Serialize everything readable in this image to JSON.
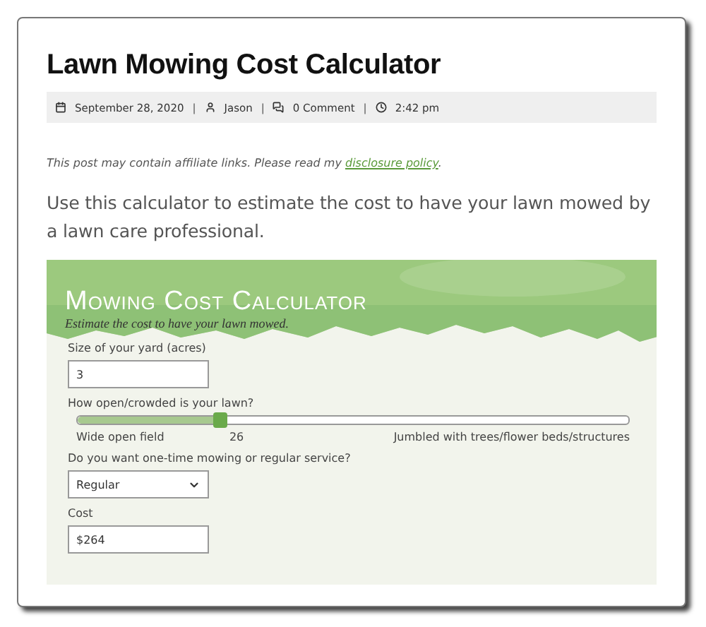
{
  "title": "Lawn Mowing Cost Calculator",
  "meta": [
    {
      "kind": "date",
      "text": "September 28, 2020"
    },
    {
      "kind": "author",
      "text": "Jason"
    },
    {
      "kind": "comments",
      "text": "0 Comment"
    },
    {
      "kind": "time",
      "text": "2:42 pm"
    }
  ],
  "separator": "|",
  "disclaimer": {
    "text": "This post may contain affiliate links. Please read my",
    "link": "disclosure policy",
    "end": "."
  },
  "intro": "Use this calculator to estimate the cost to have your lawn mowed by a lawn care professional.",
  "calculator": {
    "title": "Mowing Cost Calculator",
    "subtitle": "Estimate the cost to have your lawn mowed.",
    "fields": [
      {
        "kind": "input",
        "label": "Size of your yard (acres)",
        "value": "3"
      },
      {
        "kind": "slider",
        "label": "How open/crowded is your lawn?",
        "level": 0.26,
        "min_label": "Wide open field",
        "reading": "26",
        "max_label": "Jumbled with trees/flower beds/structures"
      },
      {
        "kind": "select",
        "label": "Do you want one-time mowing or regular service?",
        "value": "Regular"
      },
      {
        "kind": "input",
        "label": "Cost",
        "value": "$264"
      }
    ]
  }
}
